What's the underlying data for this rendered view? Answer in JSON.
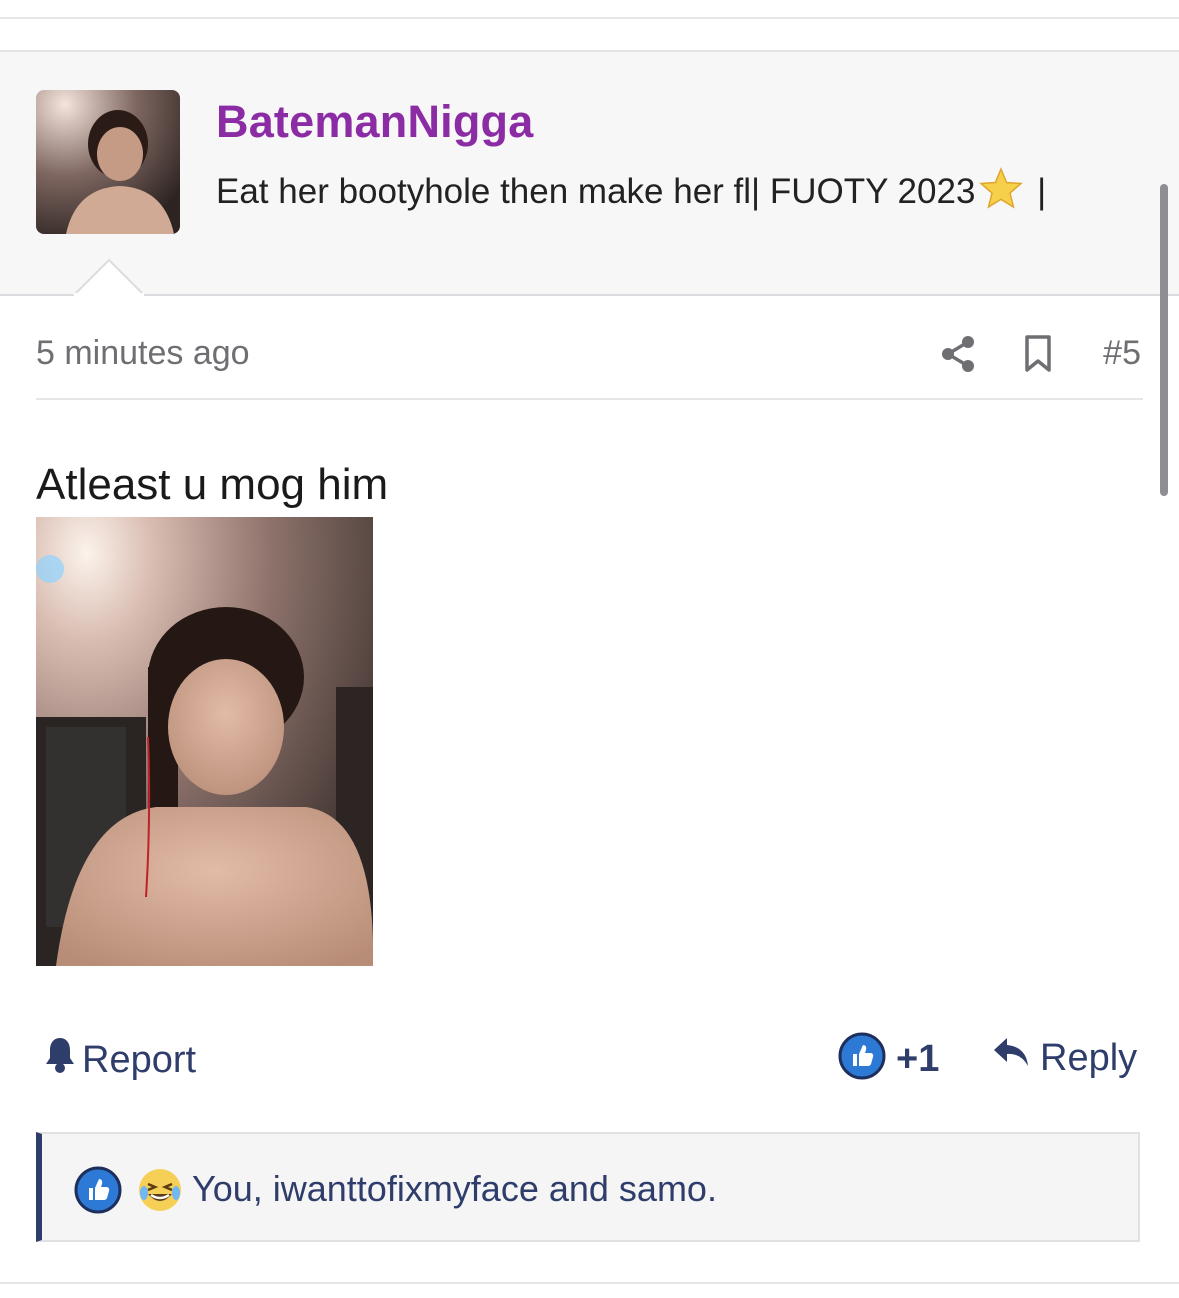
{
  "user": {
    "name": "BatemanNigga",
    "title_before_star": "Eat her bootyhole then make her fl| FUOTY 2023",
    "title_after_star": " |"
  },
  "post": {
    "time": "5 minutes ago",
    "number": "#5",
    "text": "Atleast u mog him"
  },
  "actions": {
    "report": "Report",
    "like_count": "+1",
    "reply": "Reply"
  },
  "reactions": {
    "text": "You, iwanttofixmyface and samo."
  },
  "colors": {
    "username": "#8b2ca4",
    "link": "#2f3d6b",
    "like_blue": "#2d7ad6",
    "muted": "#6e6e73"
  }
}
